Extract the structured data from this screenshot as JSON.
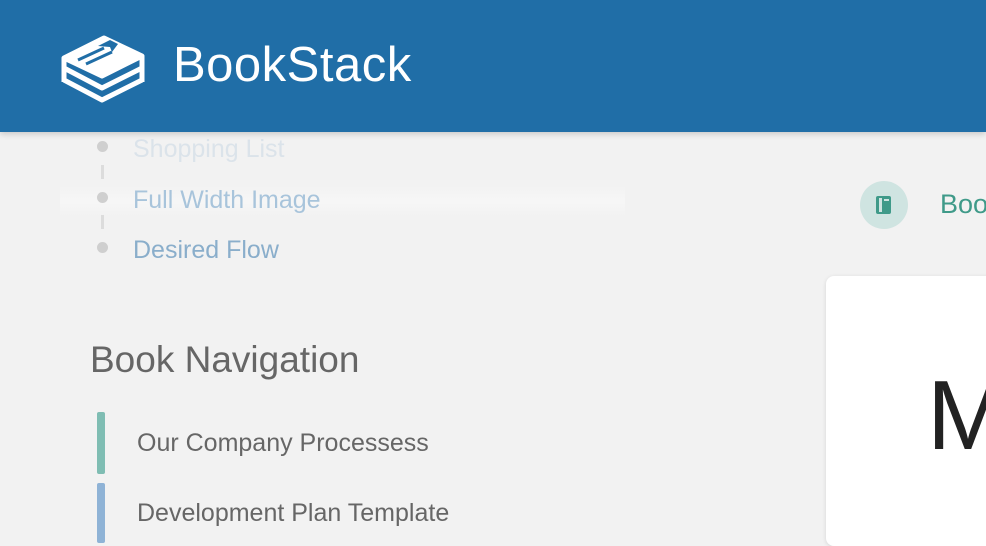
{
  "header": {
    "app_name": "BookStack",
    "logo_icon": "bookstack-logo-icon",
    "color": "#206ea7"
  },
  "chapter_nav": {
    "items": [
      {
        "label": "Shopping List"
      },
      {
        "label": "Full Width Image"
      },
      {
        "label": "Desired Flow"
      }
    ]
  },
  "book_navigation": {
    "title": "Book Navigation",
    "items": [
      {
        "label": "Our Company Processess",
        "color": "#7fbdb3"
      },
      {
        "label": "Development Plan Template",
        "color": "#8fb3d6"
      }
    ]
  },
  "breadcrumb": {
    "label": "Boo",
    "icon": "book-icon",
    "color": "#3f9a89"
  },
  "content": {
    "title_fragment": "M"
  }
}
